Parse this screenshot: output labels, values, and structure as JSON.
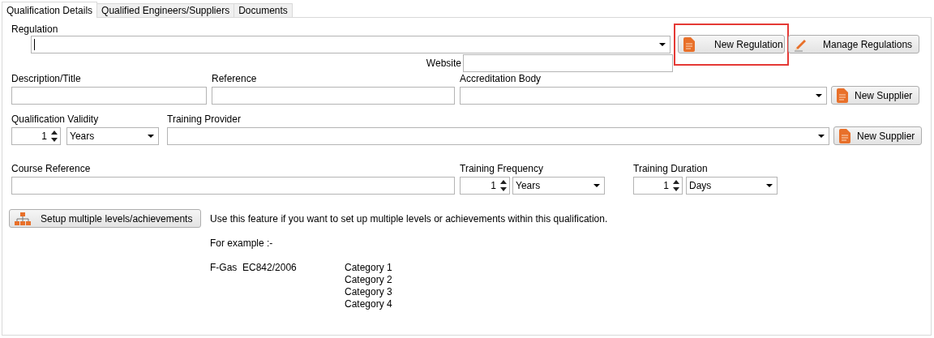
{
  "tabs": [
    {
      "label": "Qualification Details",
      "selected": true
    },
    {
      "label": "Qualified Engineers/Suppliers",
      "selected": false
    },
    {
      "label": "Documents",
      "selected": false
    }
  ],
  "regulation": {
    "label": "Regulation",
    "focused": true,
    "buttons": [
      {
        "label": "New Regulation",
        "kind": "document",
        "highlighted": true
      },
      {
        "label": "Manage Regulations",
        "kind": "pencil",
        "highlighted": false
      }
    ]
  },
  "website": {
    "label": "Website"
  },
  "description": {
    "label": "Description/Title"
  },
  "reference": {
    "label": "Reference"
  },
  "accreditation_body": {
    "label": "Accreditation Body",
    "button": "New Supplier"
  },
  "qualification_validity": {
    "label": "Qualification Validity",
    "value": "1",
    "unit": "Years"
  },
  "training_provider": {
    "label": "Training Provider",
    "button": "New Supplier"
  },
  "course_reference": {
    "label": "Course Reference"
  },
  "training_frequency": {
    "label": "Training Frequency",
    "value": "1",
    "unit": "Years"
  },
  "training_duration": {
    "label": "Training Duration",
    "value": "1",
    "unit": "Days"
  },
  "levels": {
    "button": "Setup multiple levels/achievements",
    "info": "Use this feature if you want to set up multiple levels or achievements within this qualification.",
    "example_heading": "For example :-",
    "example_name": "F-Gas  EC842/2006",
    "categories": [
      "Category 1",
      "Category 2",
      "Category 3",
      "Category 4"
    ]
  }
}
